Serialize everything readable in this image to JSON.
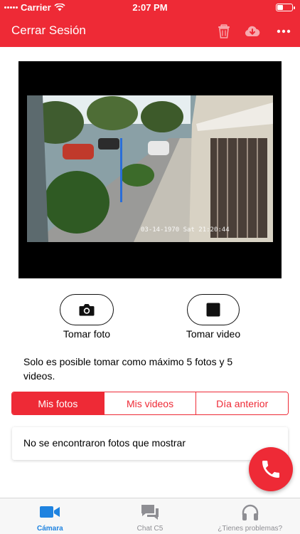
{
  "status_bar": {
    "carrier": "Carrier",
    "time": "2:07 PM"
  },
  "nav": {
    "title": "Cerrar Sesión"
  },
  "video": {
    "timestamp": "03-14-1970 Sat 21:20:44"
  },
  "actions": {
    "photo_label": "Tomar foto",
    "video_label": "Tomar video"
  },
  "info": "Solo es posible tomar como máximo 5 fotos y 5 videos.",
  "tabs_segment": [
    {
      "label": "Mis fotos",
      "active": true
    },
    {
      "label": "Mis videos",
      "active": false
    },
    {
      "label": "Día anterior",
      "active": false
    }
  ],
  "empty_message": "No se encontraron fotos que mostrar",
  "tab_bar": [
    {
      "label": "Cámara",
      "icon": "video-camera-icon",
      "active": true
    },
    {
      "label": "Chat C5",
      "icon": "chat-bubbles-icon",
      "active": false
    },
    {
      "label": "¿Tienes problemas?",
      "icon": "headphones-icon",
      "active": false
    }
  ],
  "colors": {
    "primary": "#ee2a36",
    "tab_active": "#1f83e0",
    "tab_inactive": "#8e8e93"
  }
}
